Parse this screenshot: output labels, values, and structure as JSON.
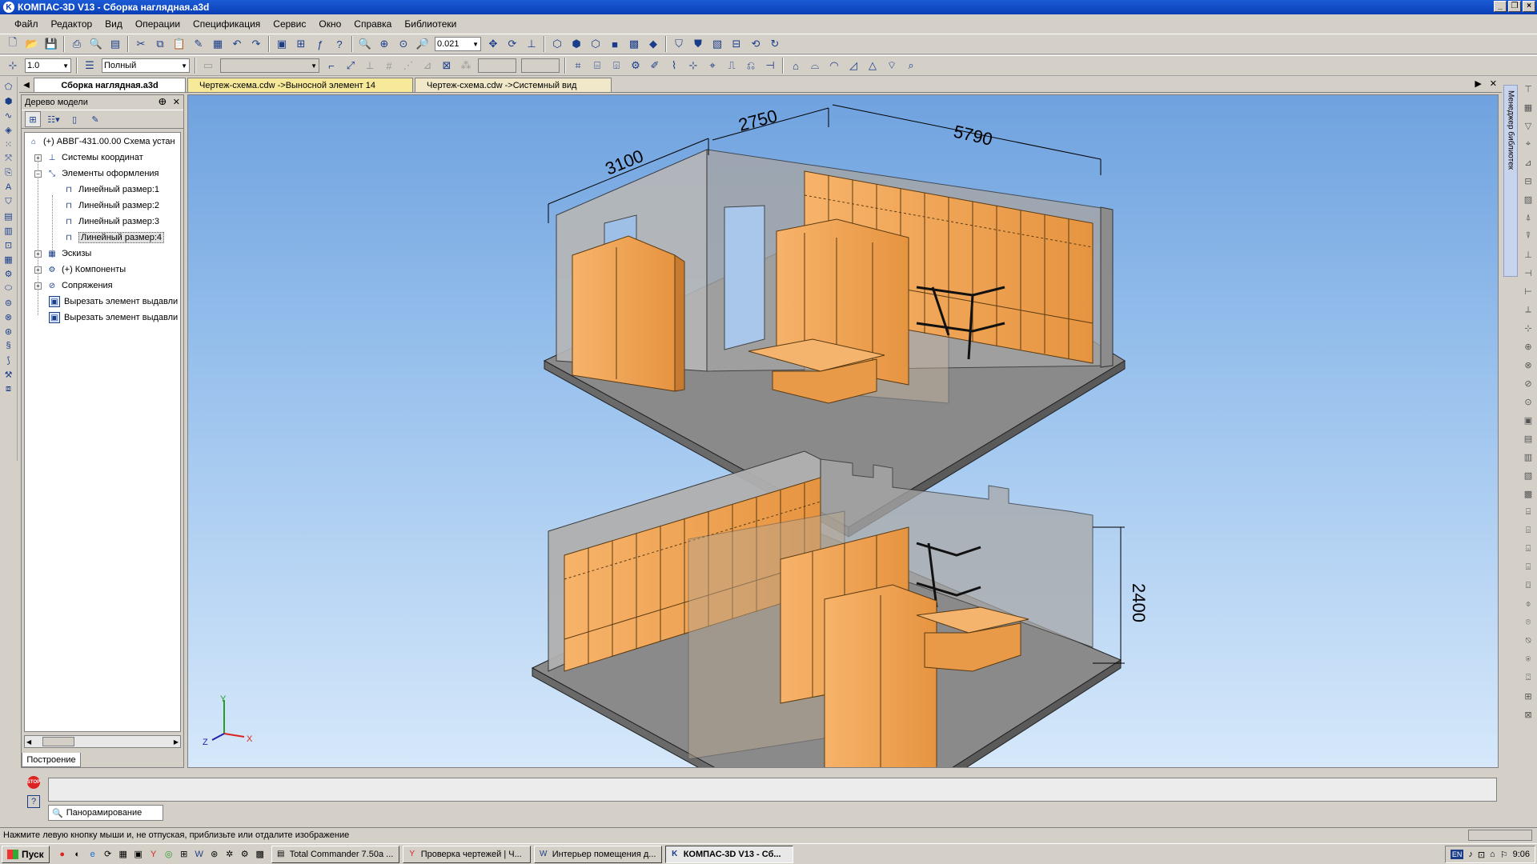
{
  "window": {
    "title": "КОМПАС-3D V13 - Сборка наглядная.a3d",
    "app_icon": "kompas-icon"
  },
  "menu": [
    "Файл",
    "Редактор",
    "Вид",
    "Операции",
    "Спецификация",
    "Сервис",
    "Окно",
    "Справка",
    "Библиотеки"
  ],
  "toolbar1": {
    "zoom_value": "0.021"
  },
  "toolbar2": {
    "step_value": "1.0",
    "style_value": "Полный"
  },
  "doc_tabs": [
    {
      "label": "Сборка наглядная.a3d"
    },
    {
      "label": "Чертеж-схема.cdw ->Выносной элемент 14"
    },
    {
      "label": "Чертеж-схема.cdw ->Системный вид"
    }
  ],
  "tree_panel": {
    "title": "Дерево модели",
    "bottom_tab": "Построение",
    "nodes": [
      "(+) АВВГ-431.00.00 Схема устан",
      "Системы координат",
      "Элементы оформления",
      "Линейный размер:1",
      "Линейный размер:2",
      "Линейный размер:3",
      "Линейный размер:4",
      "Эскизы",
      "(+) Компоненты",
      "Сопряжения",
      "Вырезать элемент выдавли",
      "Вырезать элемент выдавли"
    ]
  },
  "right_panel": {
    "library_manager": "Менеджер библиотек"
  },
  "viewport": {
    "dimensions": [
      "3100",
      "2750",
      "5790",
      "2400"
    ],
    "axes": {
      "y": "Y",
      "z": "Z",
      "x": "X"
    }
  },
  "command": {
    "panning_label": "Панорамирование",
    "stop_label": "STOP"
  },
  "status": {
    "hint": "Нажмите левую кнопку мыши и, не отпуская, приблизьте или отдалите изображение"
  },
  "taskbar": {
    "start": "Пуск",
    "buttons": [
      "Total Commander 7.50a ...",
      "Проверка чертежей | Ч...",
      "Интерьер помещения д...",
      "КОМПАС-3D V13 - Сб..."
    ],
    "lang": "EN",
    "clock": "9:06"
  },
  "colors": {
    "wood": "#f2a656",
    "wall": "#a8a8a8",
    "floor": "#8a8a8a",
    "title_bar": "#0a3fb5"
  }
}
